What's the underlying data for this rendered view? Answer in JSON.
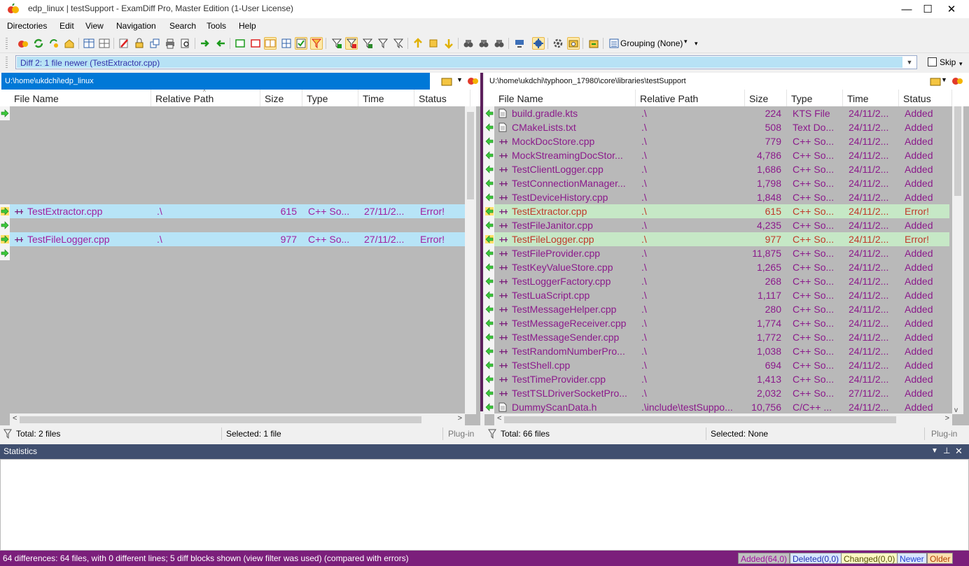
{
  "window": {
    "title": "edp_linux  |  testSupport - ExamDiff Pro, Master Edition (1-User License)",
    "minimize": "—",
    "maximize": "☐",
    "close": "✕"
  },
  "menu": [
    "Directories",
    "Edit",
    "View",
    "Navigation",
    "Search",
    "Tools",
    "Help"
  ],
  "toolbar": {
    "grouping_label": "Grouping (None)"
  },
  "diffbar": {
    "value": "Diff 2: 1 file newer (TestExtractor.cpp)",
    "skip_label": "Skip"
  },
  "left": {
    "path": "U:\\home\\ukdchi\\edp_linux",
    "columns": [
      "File Name",
      "Relative Path",
      "Size",
      "Type",
      "Time",
      "Status"
    ],
    "rows": [
      {
        "y": 0,
        "name": "",
        "path": "",
        "size": "",
        "type": "",
        "time": "",
        "status": "",
        "style": "empty"
      },
      {
        "y": 7,
        "name": "TestExtractor.cpp",
        "path": ".\\",
        "size": "615",
        "type": "C++ So...",
        "time": "27/11/2...",
        "status": "Error!",
        "style": "error"
      },
      {
        "y": 8,
        "name": "",
        "path": "",
        "size": "",
        "type": "",
        "time": "",
        "status": "",
        "style": "empty"
      },
      {
        "y": 9,
        "name": "TestFileLogger.cpp",
        "path": ".\\",
        "size": "977",
        "type": "C++ So...",
        "time": "27/11/2...",
        "status": "Error!",
        "style": "error"
      },
      {
        "y": 10,
        "name": "",
        "path": "",
        "size": "",
        "type": "",
        "time": "",
        "status": "",
        "style": "empty"
      }
    ],
    "status_total": "Total: 2 files",
    "status_selected": "Selected: 1 file",
    "status_plugin": "Plug-in"
  },
  "right": {
    "path": "U:\\home\\ukdchi\\typhoon_17980\\core\\libraries\\testSupport",
    "columns": [
      "File Name",
      "Relative Path",
      "Size",
      "Type",
      "Time",
      "Status"
    ],
    "rows": [
      {
        "name": "build.gradle.kts",
        "path": ".\\",
        "size": "224",
        "type": "KTS File",
        "time": "24/11/2...",
        "status": "Added",
        "icon": "doc",
        "style": "added"
      },
      {
        "name": "CMakeLists.txt",
        "path": ".\\",
        "size": "508",
        "type": "Text Do...",
        "time": "24/11/2...",
        "status": "Added",
        "icon": "doc",
        "style": "added"
      },
      {
        "name": "MockDocStore.cpp",
        "path": ".\\",
        "size": "779",
        "type": "C++ So...",
        "time": "24/11/2...",
        "status": "Added",
        "icon": "cpp",
        "style": "added"
      },
      {
        "name": "MockStreamingDocStor...",
        "path": ".\\",
        "size": "4,786",
        "type": "C++ So...",
        "time": "24/11/2...",
        "status": "Added",
        "icon": "cpp",
        "style": "added"
      },
      {
        "name": "TestClientLogger.cpp",
        "path": ".\\",
        "size": "1,686",
        "type": "C++ So...",
        "time": "24/11/2...",
        "status": "Added",
        "icon": "cpp",
        "style": "added"
      },
      {
        "name": "TestConnectionManager...",
        "path": ".\\",
        "size": "1,798",
        "type": "C++ So...",
        "time": "24/11/2...",
        "status": "Added",
        "icon": "cpp",
        "style": "added"
      },
      {
        "name": "TestDeviceHistory.cpp",
        "path": ".\\",
        "size": "1,848",
        "type": "C++ So...",
        "time": "24/11/2...",
        "status": "Added",
        "icon": "cpp",
        "style": "added"
      },
      {
        "name": "TestExtractor.cpp",
        "path": ".\\",
        "size": "615",
        "type": "C++ So...",
        "time": "24/11/2...",
        "status": "Error!",
        "icon": "cpp",
        "style": "error"
      },
      {
        "name": "TestFileJanitor.cpp",
        "path": ".\\",
        "size": "4,235",
        "type": "C++ So...",
        "time": "24/11/2...",
        "status": "Added",
        "icon": "cpp",
        "style": "added"
      },
      {
        "name": "TestFileLogger.cpp",
        "path": ".\\",
        "size": "977",
        "type": "C++ So...",
        "time": "24/11/2...",
        "status": "Error!",
        "icon": "cpp",
        "style": "error"
      },
      {
        "name": "TestFileProvider.cpp",
        "path": ".\\",
        "size": "11,875",
        "type": "C++ So...",
        "time": "24/11/2...",
        "status": "Added",
        "icon": "cpp",
        "style": "added"
      },
      {
        "name": "TestKeyValueStore.cpp",
        "path": ".\\",
        "size": "1,265",
        "type": "C++ So...",
        "time": "24/11/2...",
        "status": "Added",
        "icon": "cpp",
        "style": "added"
      },
      {
        "name": "TestLoggerFactory.cpp",
        "path": ".\\",
        "size": "268",
        "type": "C++ So...",
        "time": "24/11/2...",
        "status": "Added",
        "icon": "cpp",
        "style": "added"
      },
      {
        "name": "TestLuaScript.cpp",
        "path": ".\\",
        "size": "1,117",
        "type": "C++ So...",
        "time": "24/11/2...",
        "status": "Added",
        "icon": "cpp",
        "style": "added"
      },
      {
        "name": "TestMessageHelper.cpp",
        "path": ".\\",
        "size": "280",
        "type": "C++ So...",
        "time": "24/11/2...",
        "status": "Added",
        "icon": "cpp",
        "style": "added"
      },
      {
        "name": "TestMessageReceiver.cpp",
        "path": ".\\",
        "size": "1,774",
        "type": "C++ So...",
        "time": "24/11/2...",
        "status": "Added",
        "icon": "cpp",
        "style": "added"
      },
      {
        "name": "TestMessageSender.cpp",
        "path": ".\\",
        "size": "1,772",
        "type": "C++ So...",
        "time": "24/11/2...",
        "status": "Added",
        "icon": "cpp",
        "style": "added"
      },
      {
        "name": "TestRandomNumberPro...",
        "path": ".\\",
        "size": "1,038",
        "type": "C++ So...",
        "time": "24/11/2...",
        "status": "Added",
        "icon": "cpp",
        "style": "added"
      },
      {
        "name": "TestShell.cpp",
        "path": ".\\",
        "size": "694",
        "type": "C++ So...",
        "time": "24/11/2...",
        "status": "Added",
        "icon": "cpp",
        "style": "added"
      },
      {
        "name": "TestTimeProvider.cpp",
        "path": ".\\",
        "size": "1,413",
        "type": "C++ So...",
        "time": "24/11/2...",
        "status": "Added",
        "icon": "cpp",
        "style": "added"
      },
      {
        "name": "TestTSLDriverSocketPro...",
        "path": ".\\",
        "size": "2,032",
        "type": "C++ So...",
        "time": "27/11/2...",
        "status": "Added",
        "icon": "cpp",
        "style": "added"
      },
      {
        "name": "DummyScanData.h",
        "path": ".\\include\\testSuppo...",
        "size": "10,756",
        "type": "C/C++ ...",
        "time": "24/11/2...",
        "status": "Added",
        "icon": "doc",
        "style": "added"
      }
    ],
    "status_total": "Total: 66 files",
    "status_selected": "Selected: None",
    "status_plugin": "Plug-in"
  },
  "statistics": {
    "title": "Statistics"
  },
  "bottom": {
    "summary": "64 differences: 64 files, with 0 different lines; 5 diff blocks shown (view filter was used) (compared with errors)",
    "legend": [
      {
        "label": "Added(64,0)",
        "bg": "#c0c0c0",
        "fg": "#a0109f"
      },
      {
        "label": "Deleted(0,0)",
        "bg": "#d8e6ff",
        "fg": "#2030b0"
      },
      {
        "label": "Changed(0,0)",
        "bg": "#fff9c4",
        "fg": "#505000"
      },
      {
        "label": "Newer",
        "bg": "#dbe7ff",
        "fg": "#2040d0"
      },
      {
        "label": "Older",
        "bg": "#ffe0b0",
        "fg": "#b04000"
      }
    ]
  },
  "colors": {
    "added_text": "#8b1a8b",
    "error_text": "#c0392b",
    "left_error_text": "#a020a0",
    "left_path_bg": "#0078d7",
    "left_error_bg": "#b7e4f7",
    "right_error_bg": "#c6e8c6",
    "pane_bg": "#b9b9b9",
    "bottom_bg": "#7b1f7b",
    "stat_hdr": "#404f6f"
  }
}
